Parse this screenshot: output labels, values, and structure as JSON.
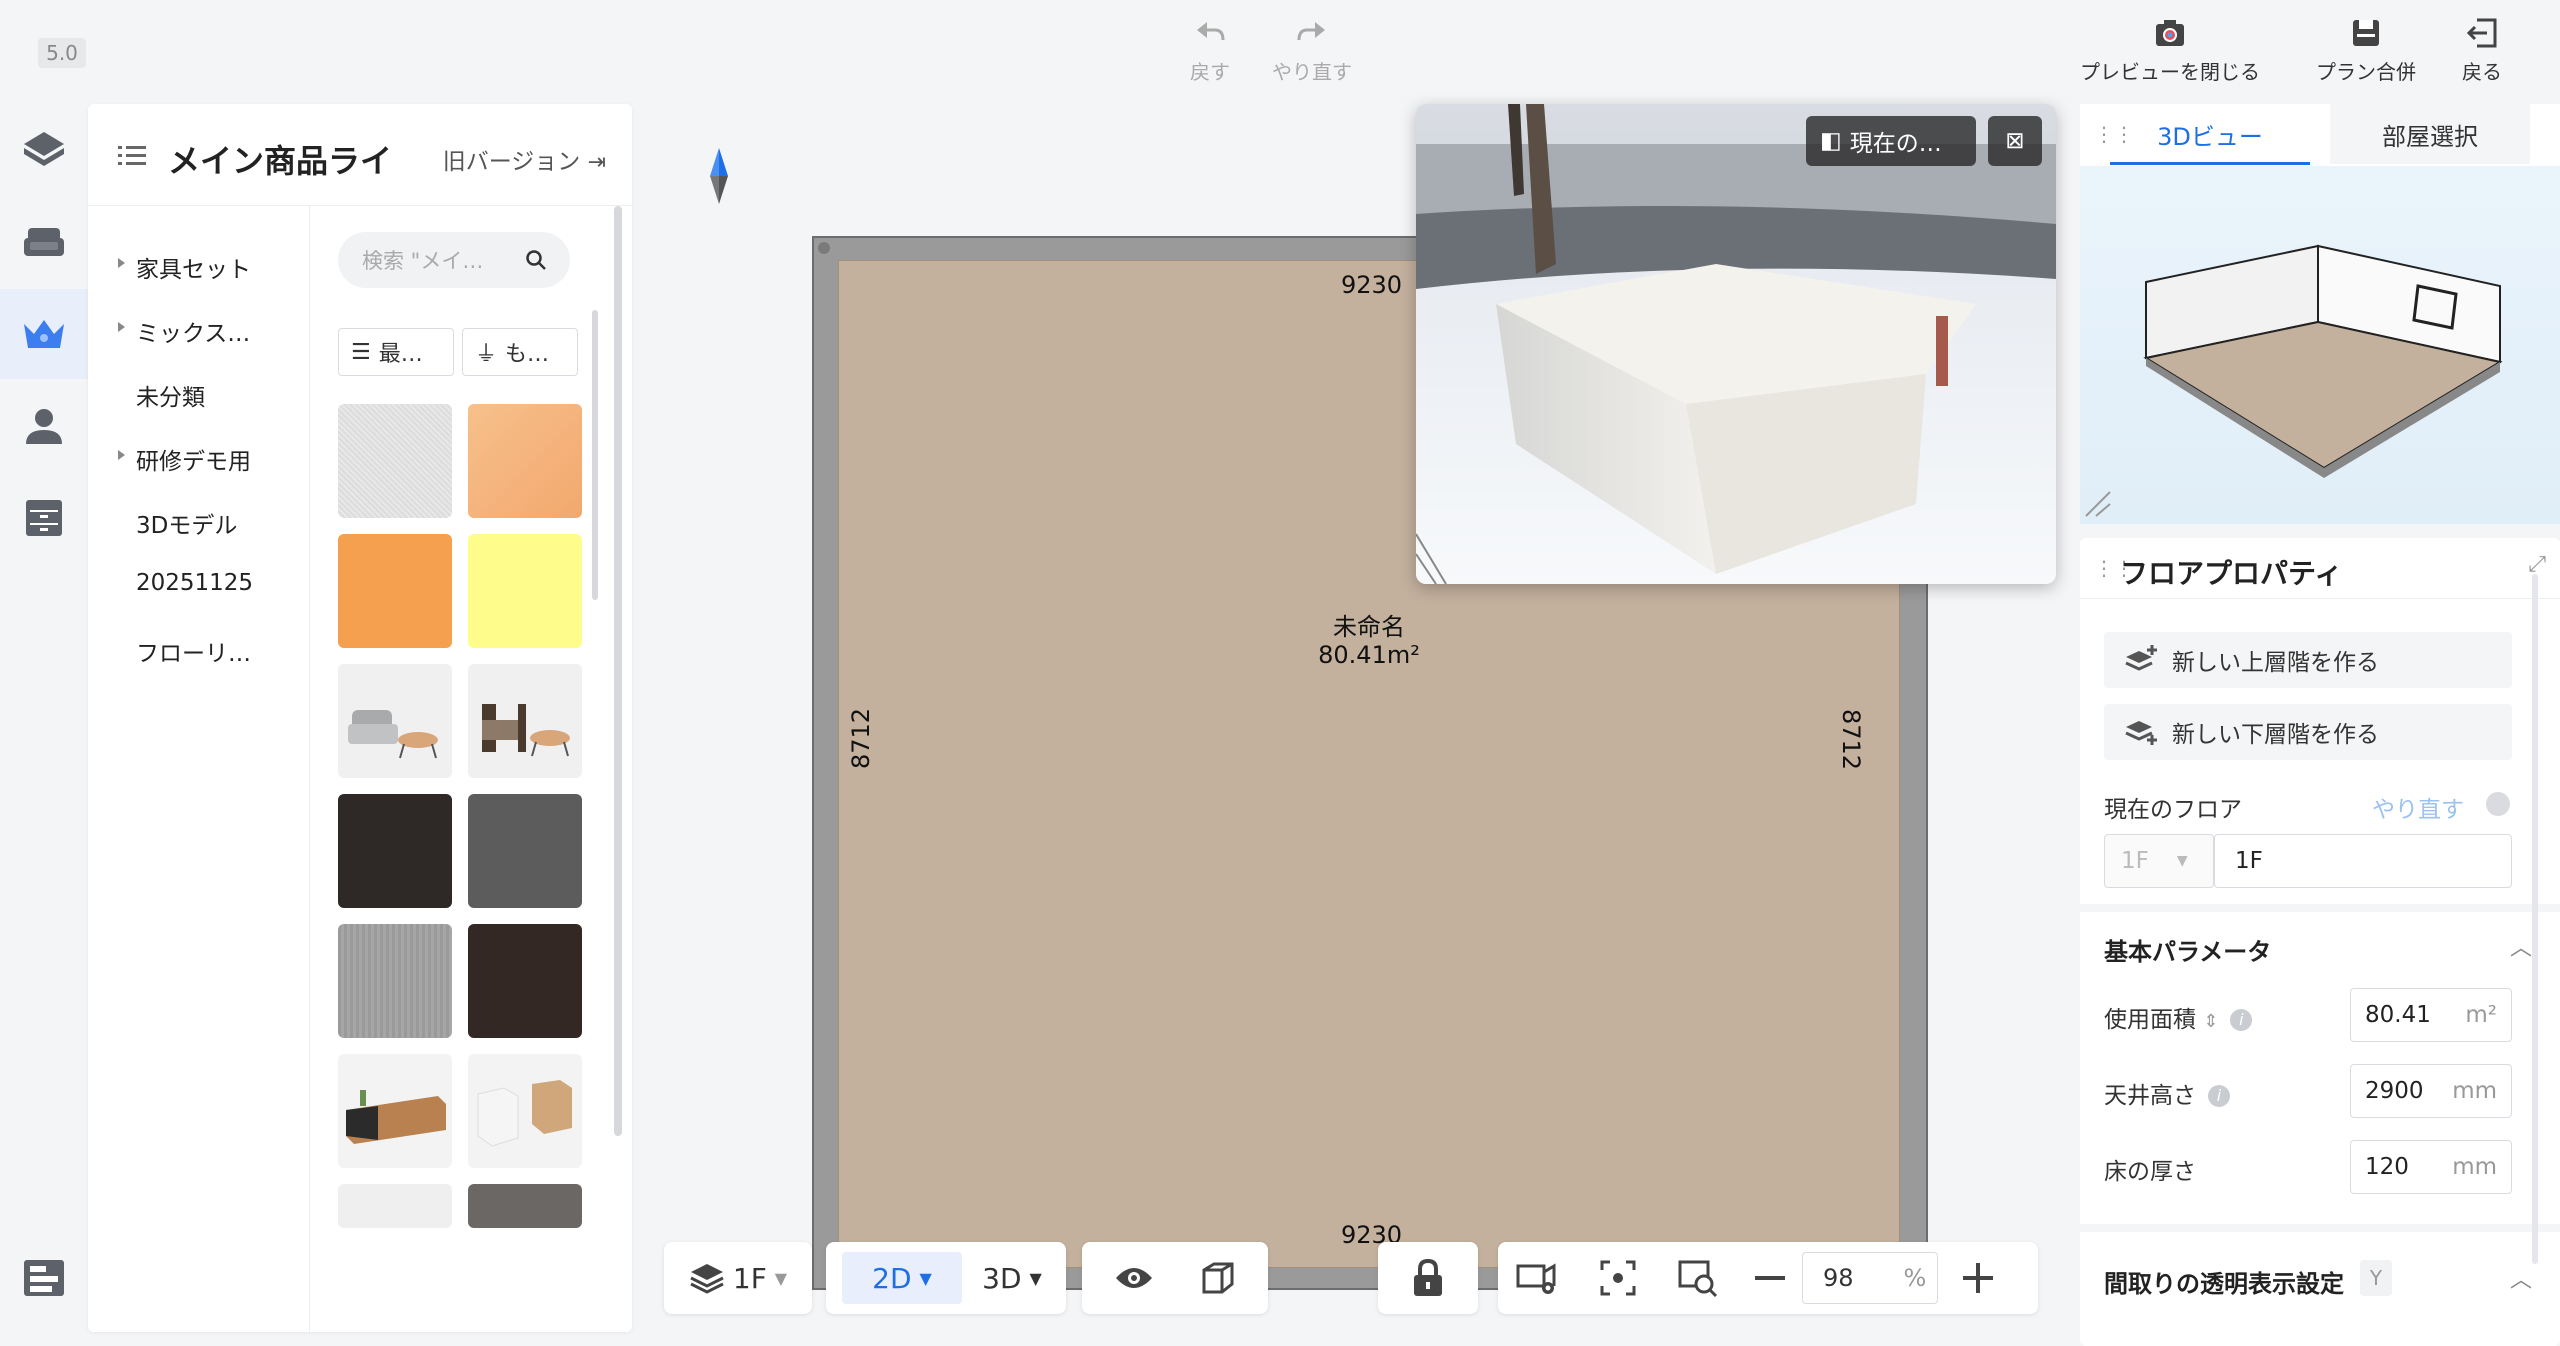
{
  "app": {
    "version": "5.0"
  },
  "toolbar": {
    "undo": "戻す",
    "redo": "やり直す",
    "close_preview": "プレビューを閉じる",
    "merge_plan": "プラン合併",
    "back": "戻る"
  },
  "library": {
    "title": "メイン商品ライ",
    "old_version": "旧バージョン",
    "categories": [
      {
        "label": "家具セット",
        "expandable": true
      },
      {
        "label": "ミックス…",
        "expandable": true
      },
      {
        "label": "未分類",
        "expandable": false
      },
      {
        "label": "研修デモ用",
        "expandable": true
      },
      {
        "label": "3Dモデル",
        "expandable": false
      },
      {
        "label": "20251125",
        "expandable": false
      },
      {
        "label": "フローリ…",
        "expandable": false
      }
    ],
    "search_placeholder": "検索 \"メイ…",
    "sort_label": "最…",
    "filter_label": "も…"
  },
  "canvas": {
    "room_name": "未命名",
    "room_area": "80.41m²",
    "dim_top": "9230",
    "dim_bottom": "9230",
    "dim_left": "8712",
    "dim_right": "8712"
  },
  "preview": {
    "view_label": "現在の…"
  },
  "bottom_toolbar": {
    "floor": "1F",
    "mode_2d": "2D",
    "mode_3d": "3D",
    "zoom_value": "98",
    "zoom_unit": "%"
  },
  "right_panel": {
    "tabs": [
      "3Dビュー",
      "部屋選択"
    ],
    "active_tab": 0,
    "properties_title": "フロアプロパティ",
    "new_upper_floor": "新しい上層階を作る",
    "new_lower_floor": "新しい下層階を作る",
    "current_floor_label": "現在のフロア",
    "redo_link": "やり直す",
    "floor_select": "1F",
    "floor_name": "1F",
    "basic_params": "基本パラメータ",
    "usable_area_label": "使用面積",
    "usable_area_value": "80.41",
    "usable_area_unit": "m²",
    "ceiling_height_label": "天井高さ",
    "ceiling_height_value": "2900",
    "ceiling_height_unit": "mm",
    "floor_thickness_label": "床の厚さ",
    "floor_thickness_value": "120",
    "floor_thickness_unit": "mm",
    "transparency_label": "間取りの透明表示設定",
    "transparency_badge": "Y"
  },
  "colors": {
    "accent": "#1e6fe6",
    "floor": "#c3b09d",
    "wall": "#9a9a9a",
    "orange": "#f5a04e",
    "yellow": "#fefd8c",
    "peach": "#f5bd8a"
  }
}
